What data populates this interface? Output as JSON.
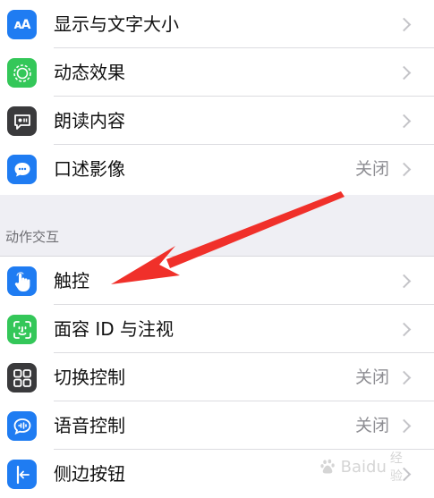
{
  "settings_top": [
    {
      "label": "显示与文字大小",
      "value": "",
      "icon": "text-size-icon",
      "color": "#1f7cf2"
    },
    {
      "label": "动态效果",
      "value": "",
      "icon": "motion-icon",
      "color": "#34c759"
    },
    {
      "label": "朗读内容",
      "value": "",
      "icon": "speech-icon",
      "color": "#3a3a3c"
    },
    {
      "label": "口述影像",
      "value": "关闭",
      "icon": "audio-description-icon",
      "color": "#1f7cf2"
    }
  ],
  "section_interaction": {
    "header": "动作交互",
    "items": [
      {
        "label": "触控",
        "value": "",
        "icon": "touch-hand-icon",
        "color": "#1f7cf2"
      },
      {
        "label": "面容 ID 与注视",
        "value": "",
        "icon": "face-id-icon",
        "color": "#34c759"
      },
      {
        "label": "切换控制",
        "value": "关闭",
        "icon": "switch-control-icon",
        "color": "#3a3a3c"
      },
      {
        "label": "语音控制",
        "value": "关闭",
        "icon": "voice-control-icon",
        "color": "#1f7cf2"
      },
      {
        "label": "侧边按钮",
        "value": "",
        "icon": "side-button-icon",
        "color": "#1f7cf2"
      }
    ]
  },
  "annotation": {
    "arrow_color": "#f0302a"
  },
  "watermark": {
    "text": "Baidu",
    "sub": "经验"
  }
}
